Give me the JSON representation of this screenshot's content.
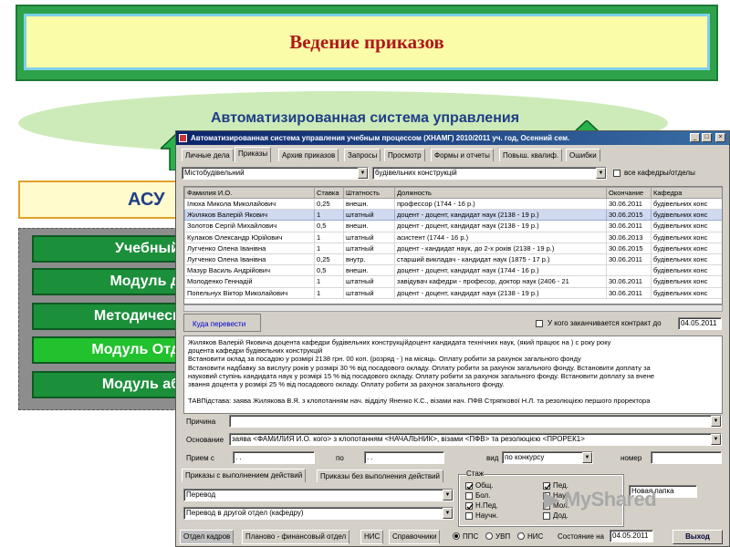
{
  "banner": {
    "title": "Ведение приказов"
  },
  "cloud": {
    "text": "Автоматизированная система управления"
  },
  "asu": {
    "label": "АСУ"
  },
  "menu": [
    {
      "label": "Учебный"
    },
    {
      "label": "Модуль д"
    },
    {
      "label": "Методическ"
    },
    {
      "label": "Модуль Отд"
    },
    {
      "label": "Модуль аб"
    }
  ],
  "window": {
    "title": "Автоматизированная система управления учебным процессом        (ХНАМГ)     2010/2011 уч. год, Осенний сем.",
    "tabs": [
      "Личные дела",
      "Приказы",
      "Архив приказов",
      "Запросы",
      "Просмотр",
      "Формы и отчеты",
      "Повыш. квалиф.",
      "Ошибки"
    ],
    "filter_left": "Містобудівельний",
    "filter_right": "будівельних конструкцій",
    "all_depts_label": "все кафедры/отделы",
    "columns": [
      "Фамилия И.О.",
      "Ставка",
      "Штатность",
      "Должность",
      "Окончание",
      "Кафедра"
    ],
    "rows": [
      [
        "Ілюха Микола Миколайович",
        "0,25",
        "внешн.",
        "профессор (1744 - 16 р.)",
        "30.06.2011",
        "будівельних конс"
      ],
      [
        "Жиляков Валерій Якович",
        "1",
        "штатный",
        "доцент - доцент, кандидат наук (2138 - 19 р.)",
        "30.06.2015",
        "будівельних конс"
      ],
      [
        "Золотов Сергій Михайлович",
        "0,5",
        "внешн.",
        "доцент - доцент, кандидат наук (2138 - 19 р.)",
        "30.06.2011",
        "будівельних конс"
      ],
      [
        "Кулаков Олександр Юрійович",
        "1",
        "штатный",
        "асистент (1744 - 16 р.)",
        "30.06.2013",
        "будівельних конс"
      ],
      [
        "Лугченко Олена Іванівна",
        "1",
        "штатный",
        "доцент - кандидат наук, до 2-х років (2138 - 19 р.)",
        "30.06.2015",
        "будівельних конс"
      ],
      [
        "Лугченко Олена Іванівна",
        "0,25",
        "внутр.",
        "старший викладач - кандидат наук (1875 - 17 р.)",
        "30.06.2011",
        "будівельних конс"
      ],
      [
        "Мазур Василь Андрійович",
        "0,5",
        "внешн.",
        "доцент - доцент, кандидат наук (1744 - 16 р.)",
        "",
        "будівельних конс"
      ],
      [
        "Молоденко Геннадій",
        "1",
        "штатный",
        "завідувач кафедри - професор, доктор наук (2406 - 21",
        "30.06.2011",
        "будівельних конс"
      ],
      [
        "Попельнух Віктор Миколайович",
        "1",
        "штатный",
        "доцент - доцент, кандидат наук (2138 - 19 р.)",
        "30.06.2011",
        "будівельних конс"
      ]
    ],
    "move_button": "Куда перевести",
    "contract_label": "У кого заканчивается контракт до",
    "contract_date": "04.05.2011",
    "memo_lines": [
      "       Жиляков Валерій Яковича доцента кафедри будівельних конструкційдоцент кандидата технічних наук, (який працює на ) с року року",
      "доцента кафедри будівельних конструкцій",
      "       Встановити оклад за посадою у розмірі 2138 грн. 00 коп. (розряд - ) на місяць. Оплату робити за рахунок загального фонду",
      "Встановити надбавку за вислугу років у розмірі 30 % від посадового окладу. Оплату робити за рахунок загального фонду. Встановити доплату за",
      "науковий ступінь кандидата наук у розмірі 15 % від посадового окладу. Оплату робити за рахунок загального фонду. Встановити доплату за вчене",
      "звання доцента у розмірі 25 % від посадового окладу. Оплату робити за рахунок загального фонду.",
      "",
      "ТАВПідстава: заява Жилякова В.Я. з клопотанням нач. відділу Яненко К.С., візами нач. ПФВ Стряпкової Н.Л. та резолюцією першого проректора"
    ],
    "reason_label": "Причина",
    "basis_label": "Основание",
    "basis_value": "заява <ФАМИЛИЯ И.О. кого> з клопотанням <НАЧАЛЬНИК>, візами <ПФВ> та резолюцією <ПРОРЕК1>",
    "hire_from_label": "Прием с",
    "hire_from_value": ". .",
    "to_label": "по",
    "to_value": ". .",
    "type_label": "вид",
    "type_value": "по конкурсу",
    "number_label": "номер",
    "orders_tab1": "Приказы с выполнением действий",
    "orders_tab2": "Приказы без выполнения действий",
    "order_type1": "Перевод",
    "order_type2": "Перевод в другой отдел (кафедру)",
    "stazh_title": "Стаж",
    "stazh_left": [
      "Общ.",
      "Бол.",
      "Н.Пед.",
      "Научн."
    ],
    "stazh_right": [
      "Пед.",
      "Науч.",
      "Мол.",
      "Дод."
    ],
    "new_folder": "Новая папка",
    "bottom_tabs": [
      "Отдел кадров",
      "Планово - финансовый отдел",
      "НИС",
      "Справочники"
    ],
    "radio_labels": [
      "ППС",
      "УВП",
      "НИС"
    ],
    "state_label": "Состояние на",
    "state_date": "04.05.2011",
    "exit_button": "Выход"
  },
  "watermark": "MyShared"
}
